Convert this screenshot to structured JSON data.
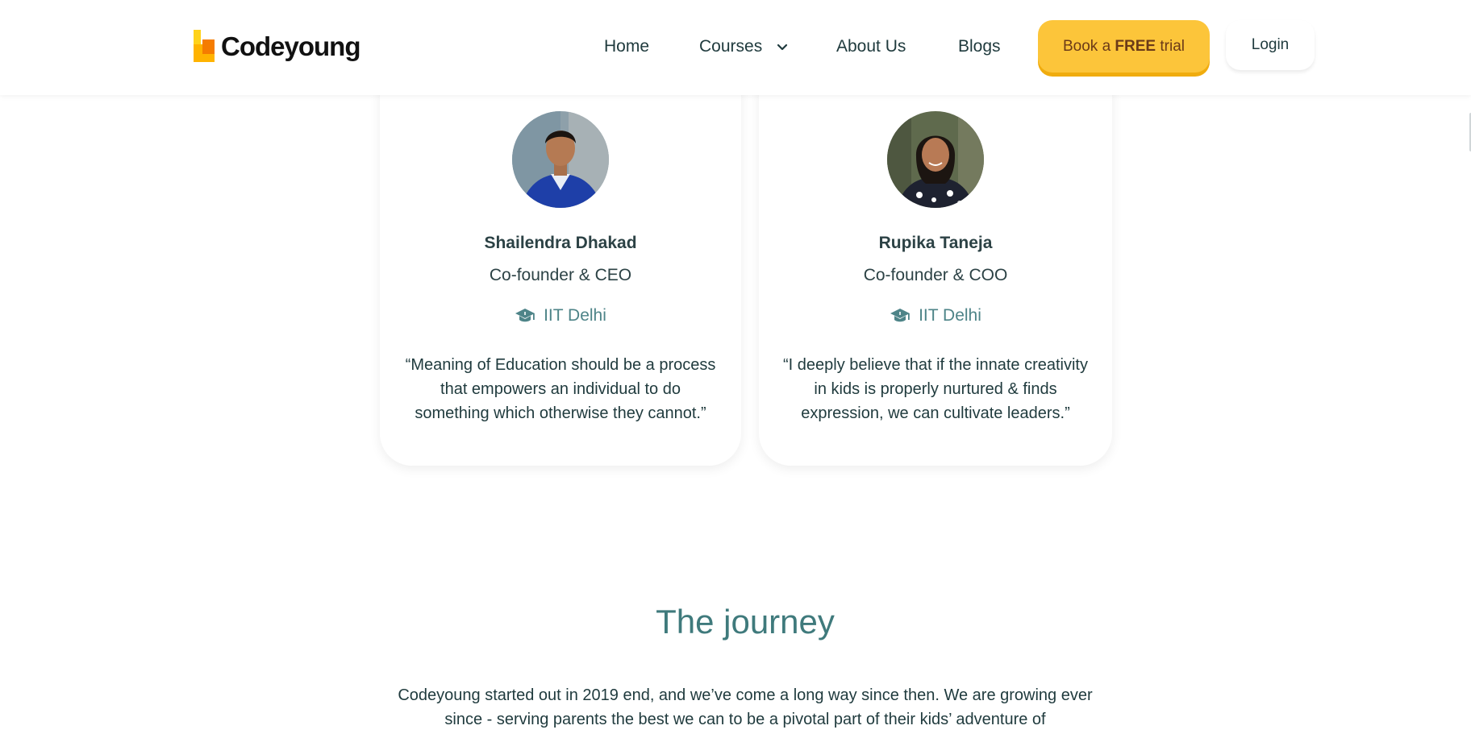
{
  "header": {
    "logo_text": "Codeyoung",
    "nav": {
      "home": "Home",
      "courses": "Courses",
      "about": "About Us",
      "blogs": "Blogs"
    },
    "trial_button": {
      "prefix": "Book a ",
      "emphasis": "FREE",
      "suffix": " trial"
    },
    "login_button": "Login"
  },
  "founders": [
    {
      "name": "Shailendra Dhakad",
      "role": "Co-founder & CEO",
      "education": "IIT Delhi",
      "quote": "“Meaning of Education should be a process that empowers an individual to do something which otherwise they cannot.”"
    },
    {
      "name": "Rupika Taneja",
      "role": "Co-founder & COO",
      "education": "IIT Delhi",
      "quote": "“I deeply believe that if the innate creativity in kids is properly nurtured & finds expression, we can cultivate leaders.”"
    }
  ],
  "journey": {
    "title": "The journey",
    "text": "Codeyoung started out in 2019 end, and we’ve come a long way since then. We are growing ever since - serving parents the best we can to be a pivotal part of their kids’ adventure of"
  },
  "colors": {
    "accent_yellow": "#fcc53a",
    "teal_heading": "#3f7a7c",
    "text_dark": "#1f3a3d"
  }
}
